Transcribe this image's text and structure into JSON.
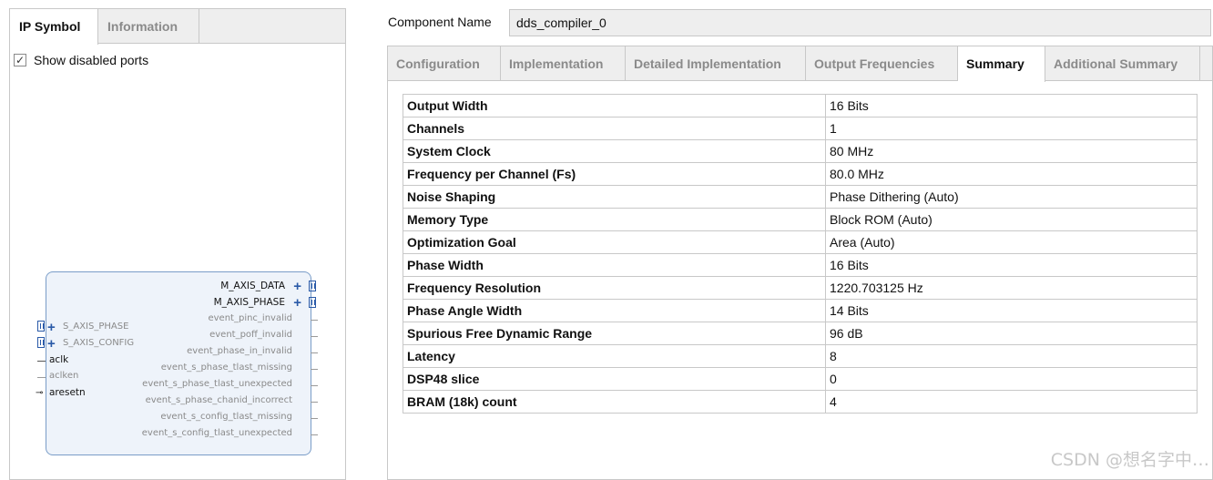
{
  "left_panel": {
    "tabs": [
      {
        "label": "IP Symbol",
        "active": true
      },
      {
        "label": "Information",
        "active": false
      }
    ],
    "show_disabled_ports": {
      "label": "Show disabled ports",
      "checked": true,
      "check_glyph": "✓"
    }
  },
  "ip_symbol": {
    "right_ports": [
      {
        "name": "M_AXIS_DATA",
        "enabled": true,
        "bus": true
      },
      {
        "name": "M_AXIS_PHASE",
        "enabled": true,
        "bus": true
      },
      {
        "name": "event_pinc_invalid",
        "enabled": false
      },
      {
        "name": "event_poff_invalid",
        "enabled": false
      },
      {
        "name": "event_phase_in_invalid",
        "enabled": false
      },
      {
        "name": "event_s_phase_tlast_missing",
        "enabled": false
      },
      {
        "name": "event_s_phase_tlast_unexpected",
        "enabled": false
      },
      {
        "name": "event_s_phase_chanid_incorrect",
        "enabled": false
      },
      {
        "name": "event_s_config_tlast_missing",
        "enabled": false
      },
      {
        "name": "event_s_config_tlast_unexpected",
        "enabled": false
      }
    ],
    "left_ports": [
      {
        "name": "S_AXIS_PHASE",
        "enabled": false,
        "bus": true
      },
      {
        "name": "S_AXIS_CONFIG",
        "enabled": false,
        "bus": true
      },
      {
        "name": "aclk",
        "enabled": true
      },
      {
        "name": "aclken",
        "enabled": false
      },
      {
        "name": "aresetn",
        "enabled": true,
        "inverted": true
      }
    ]
  },
  "component": {
    "label": "Component Name",
    "value": "dds_compiler_0"
  },
  "right_tabs": [
    {
      "label": "Configuration",
      "active": false
    },
    {
      "label": "Implementation",
      "active": false
    },
    {
      "label": "Detailed Implementation",
      "active": false
    },
    {
      "label": "Output Frequencies",
      "active": false
    },
    {
      "label": "Summary",
      "active": true
    },
    {
      "label": "Additional Summary",
      "active": false
    }
  ],
  "summary": [
    {
      "key": "Output Width",
      "value": "16 Bits"
    },
    {
      "key": "Channels",
      "value": "1"
    },
    {
      "key": "System Clock",
      "value": "80 MHz"
    },
    {
      "key": "Frequency per Channel (Fs)",
      "value": "80.0 MHz"
    },
    {
      "key": "Noise Shaping",
      "value": "Phase Dithering (Auto)"
    },
    {
      "key": "Memory Type",
      "value": "Block ROM (Auto)"
    },
    {
      "key": "Optimization Goal",
      "value": "Area (Auto)"
    },
    {
      "key": "Phase Width",
      "value": "16 Bits"
    },
    {
      "key": "Frequency Resolution",
      "value": "1220.703125 Hz"
    },
    {
      "key": "Phase Angle Width",
      "value": "14 Bits"
    },
    {
      "key": "Spurious Free Dynamic Range",
      "value": "96 dB"
    },
    {
      "key": "Latency",
      "value": "8"
    },
    {
      "key": "DSP48 slice",
      "value": "0"
    },
    {
      "key": "BRAM (18k) count",
      "value": "4"
    }
  ],
  "watermark": "CSDN @想名字中…"
}
